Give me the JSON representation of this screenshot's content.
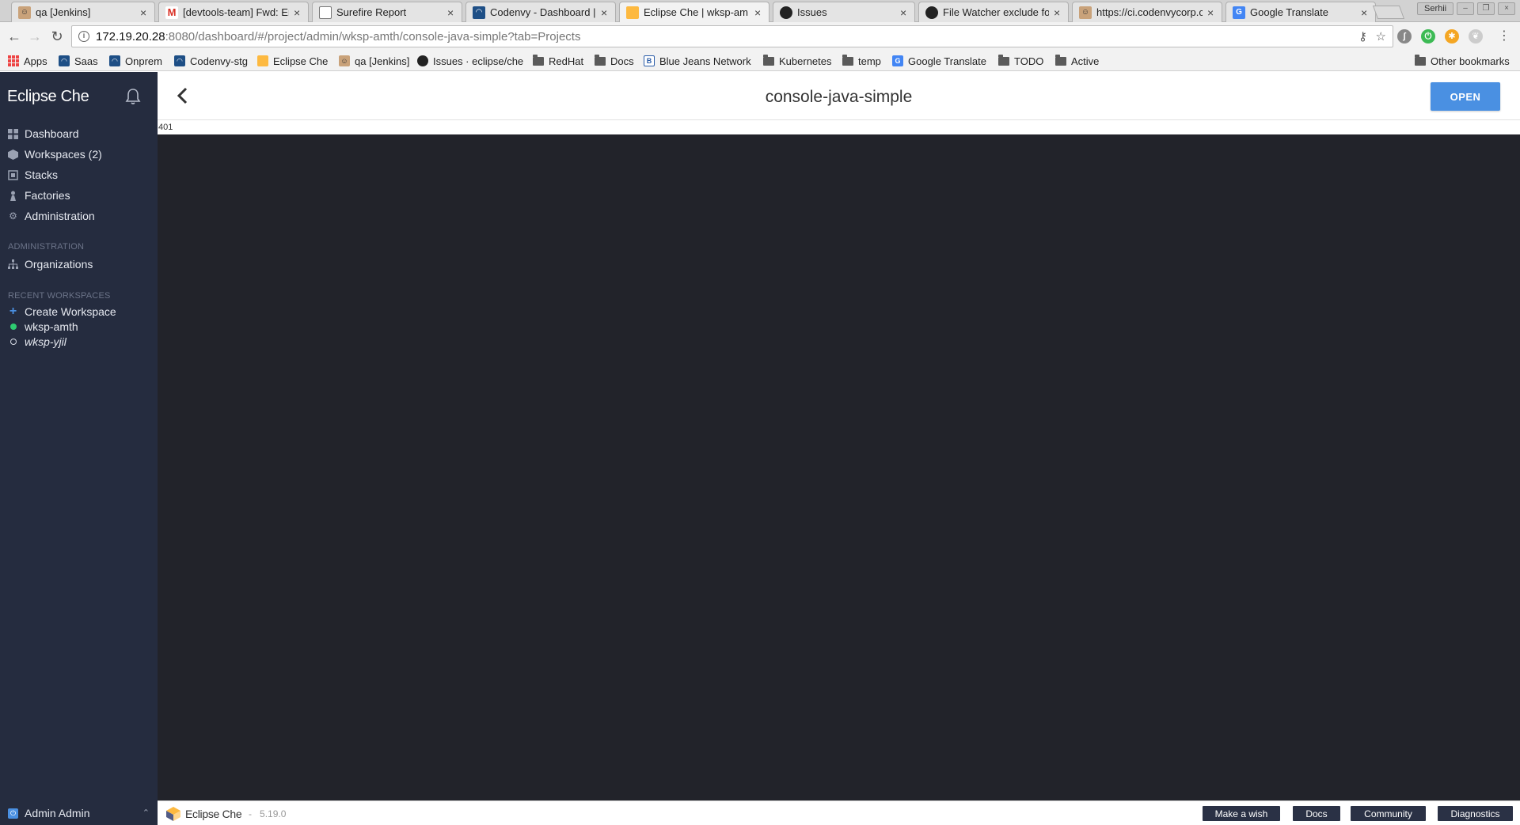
{
  "browser": {
    "tabs": [
      {
        "title": "qa [Jenkins]",
        "favicon": "jenkins-icon",
        "active": false
      },
      {
        "title": "[devtools-team] Fwd: Er",
        "favicon": "gmail-icon",
        "active": false
      },
      {
        "title": "Surefire Report",
        "favicon": "document-icon",
        "active": false
      },
      {
        "title": "Codenvy - Dashboard |",
        "favicon": "codenvy-icon",
        "active": false
      },
      {
        "title": "Eclipse Che | wksp-am",
        "favicon": "eclipse-che-icon",
        "active": true
      },
      {
        "title": "Issues",
        "favicon": "github-icon",
        "active": false
      },
      {
        "title": "File Watcher exclude fo",
        "favicon": "github-icon",
        "active": false
      },
      {
        "title": "https://ci.codenvycorp.c",
        "favicon": "jenkins-icon",
        "active": false
      },
      {
        "title": "Google Translate",
        "favicon": "google-translate-icon",
        "active": false
      }
    ],
    "profile_name": "Serhii",
    "url_host": "172.19.20.28",
    "url_rest": ":8080/dashboard/#/project/admin/wksp-amth/console-java-simple?tab=Projects",
    "bookmarks": [
      {
        "label": "Apps",
        "icon": "apps-icon"
      },
      {
        "label": "Saas",
        "icon": "codenvy-icon"
      },
      {
        "label": "Onprem",
        "icon": "codenvy-icon"
      },
      {
        "label": "Codenvy-stg",
        "icon": "codenvy-icon"
      },
      {
        "label": "Eclipse Che",
        "icon": "eclipse-che-icon"
      },
      {
        "label": "qa [Jenkins]",
        "icon": "jenkins-icon"
      },
      {
        "label": "Issues · eclipse/che",
        "icon": "github-icon"
      },
      {
        "label": "RedHat",
        "icon": "folder-icon"
      },
      {
        "label": "Docs",
        "icon": "folder-icon"
      },
      {
        "label": "Blue Jeans Network",
        "icon": "bluejeans-icon"
      },
      {
        "label": "Kubernetes",
        "icon": "folder-icon"
      },
      {
        "label": "temp",
        "icon": "folder-icon"
      },
      {
        "label": "Google Translate",
        "icon": "google-translate-icon"
      },
      {
        "label": "TODO",
        "icon": "folder-icon"
      },
      {
        "label": "Active",
        "icon": "folder-icon"
      }
    ],
    "other_bookmarks": "Other bookmarks"
  },
  "sidebar": {
    "brand": "Eclipse Che",
    "nav": [
      {
        "label": "Dashboard",
        "icon": "dashboard-icon"
      },
      {
        "label": "Workspaces (2)",
        "icon": "workspaces-icon"
      },
      {
        "label": "Stacks",
        "icon": "stacks-icon"
      },
      {
        "label": "Factories",
        "icon": "factories-icon"
      },
      {
        "label": "Administration",
        "icon": "gear-icon"
      }
    ],
    "admin_section": {
      "heading": "ADMINISTRATION",
      "items": [
        {
          "label": "Organizations",
          "icon": "organizations-icon"
        }
      ]
    },
    "recent_section": {
      "heading": "RECENT WORKSPACES",
      "create_label": "Create Workspace",
      "workspaces": [
        {
          "name": "wksp-amth",
          "status": "running"
        },
        {
          "name": "wksp-yjil",
          "status": "stopped"
        }
      ]
    },
    "user": "Admin Admin"
  },
  "page": {
    "title": "console-java-simple",
    "open_label": "OPEN",
    "status_code": "401"
  },
  "footer": {
    "brand": "Eclipse Che",
    "separator": "-",
    "version": "5.19.0",
    "buttons": [
      "Make a wish",
      "Docs",
      "Community",
      "Diagnostics"
    ]
  },
  "colors": {
    "sidebar_bg": "#252c3f",
    "accent": "#4a90e2",
    "ide_bg": "#22232a",
    "running": "#2ecc71"
  }
}
